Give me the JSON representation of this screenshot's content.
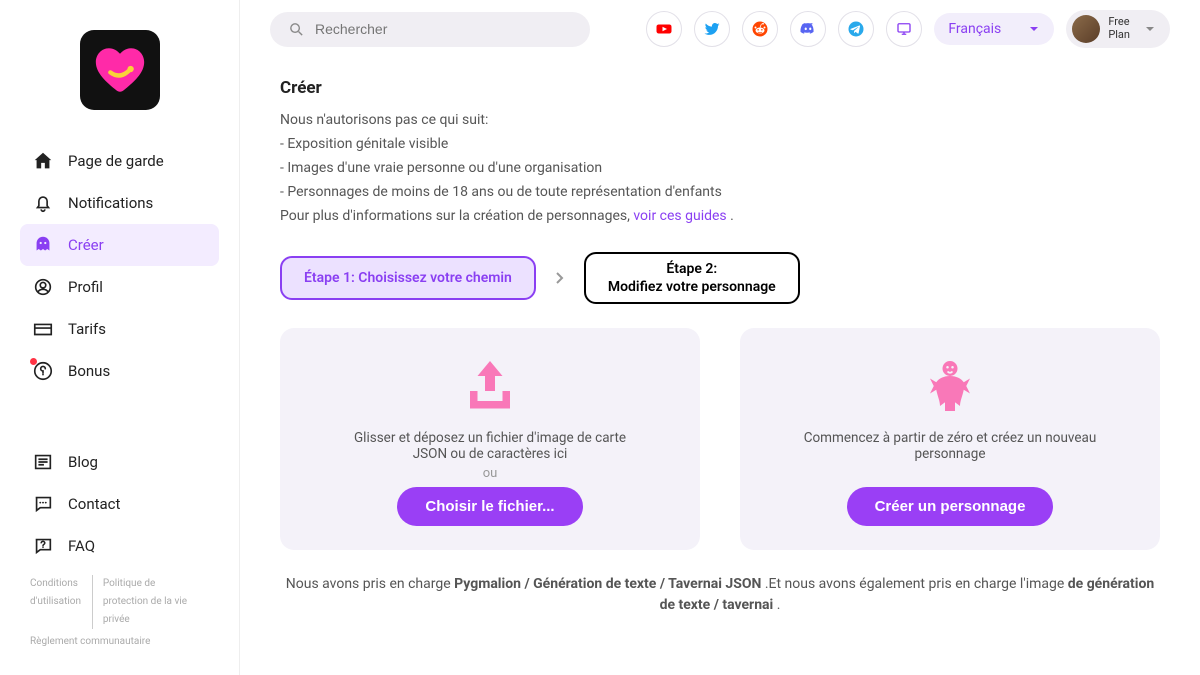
{
  "search": {
    "placeholder": "Rechercher"
  },
  "lang": {
    "label": "Français"
  },
  "plan": {
    "line1": "Free",
    "line2": "Plan"
  },
  "sidebar": {
    "items": [
      {
        "label": "Page de garde"
      },
      {
        "label": "Notifications"
      },
      {
        "label": "Créer"
      },
      {
        "label": "Profil"
      },
      {
        "label": "Tarifs"
      },
      {
        "label": "Bonus"
      }
    ],
    "lower": [
      {
        "label": "Blog"
      },
      {
        "label": "Contact"
      },
      {
        "label": "FAQ"
      }
    ],
    "footer": {
      "a": "Conditions d'utilisation",
      "b": "Politique de protection de la vie privée",
      "c": "Règlement communautaire"
    }
  },
  "content": {
    "title": "Créer",
    "intro": "Nous n'autorisons pas ce qui suit:",
    "rule1": "- Exposition génitale visible",
    "rule2": "- Images d'une vraie personne ou d'une organisation",
    "rule3": "- Personnages de moins de 18 ans ou de toute représentation d'enfants",
    "guide_pre": "Pour plus d'informations sur la création de personnages, ",
    "guide_link": "voir ces guides",
    "guide_post": " .",
    "step1": "Étape 1:  Choisissez votre chemin",
    "step2a": "Étape 2:",
    "step2b": "Modifiez votre personnage",
    "card1_text": "Glisser et déposez un fichier d'image de carte JSON ou de caractères ici",
    "card1_or": "ou",
    "card1_btn": "Choisir le fichier...",
    "card2_text": "Commencez à partir de zéro et créez un nouveau personnage",
    "card2_btn": "Créer un personnage",
    "support_pre": "Nous avons pris en charge ",
    "support_bold1": "Pygmalion / Génération de texte / Tavernai JSON",
    "support_mid": " .Et nous avons également pris en charge l'image ",
    "support_bold2": "de génération de texte / tavernai",
    "support_end": " ."
  }
}
